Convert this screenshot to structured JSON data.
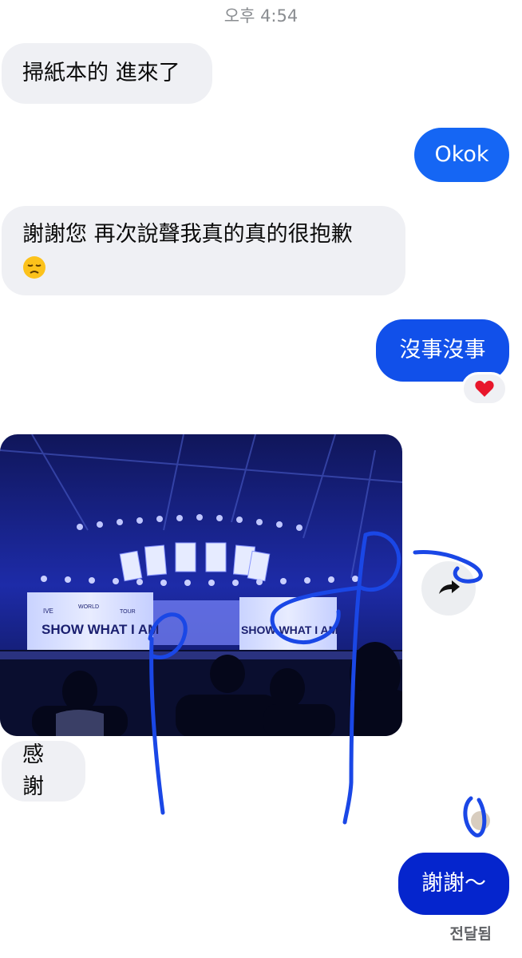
{
  "header": {
    "timestamp": "오후 4:54"
  },
  "messages": [
    {
      "direction": "incoming",
      "text": "掃紙本的 進來了"
    },
    {
      "direction": "outgoing",
      "text": "Okok"
    },
    {
      "direction": "incoming",
      "text": "謝謝您 再次說聲我真的真的很抱歉",
      "emoji": "disappointed-face"
    },
    {
      "direction": "outgoing",
      "text": "沒事沒事",
      "reaction": "red-heart"
    },
    {
      "direction": "incoming",
      "type": "photo",
      "photo_text": {
        "line1_small": "IVE",
        "line1_world": "WORLD",
        "line1_tour": "TOUR",
        "headline": "SHOW WHAT I AM"
      }
    },
    {
      "direction": "incoming",
      "text": "感謝"
    },
    {
      "direction": "outgoing",
      "text": "謝謝～"
    }
  ],
  "status": {
    "text": "전달됨"
  },
  "colors": {
    "incoming_bubble": "#eff0f4",
    "outgoing_1": "#1566f4",
    "outgoing_2": "#1150ea",
    "outgoing_3": "#0525cd",
    "scribble": "#1a47e6"
  },
  "icons": {
    "share": "share-forward-icon",
    "reaction": "red-heart",
    "emoji": "disappointed-face"
  }
}
